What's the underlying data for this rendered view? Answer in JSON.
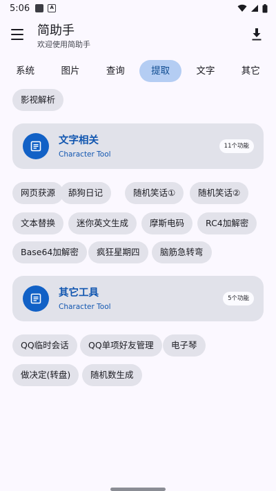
{
  "status": {
    "time": "5:06",
    "notif_letter": "A"
  },
  "app": {
    "title": "简助手",
    "subtitle": "欢迎使用简助手"
  },
  "tabs": [
    {
      "label": "系统",
      "active": false
    },
    {
      "label": "图片",
      "active": false
    },
    {
      "label": "查询",
      "active": false
    },
    {
      "label": "提取",
      "active": true
    },
    {
      "label": "文字",
      "active": false
    },
    {
      "label": "其它",
      "active": false
    }
  ],
  "top_chip": "影视解析",
  "section_text": {
    "title": "文字相关",
    "subtitle": "Character Tool",
    "badge": "11个功能",
    "items": [
      "网页获源",
      "舔狗日记",
      "随机笑话①",
      "随机笑话②",
      "文本替换",
      "迷你英文生成",
      "摩斯电码",
      "RC4加解密",
      "Base64加解密",
      "疯狂星期四",
      "脑筋急转弯"
    ]
  },
  "section_other": {
    "title": "其它工具",
    "subtitle": "Character Tool",
    "badge": "5个功能",
    "items": [
      "QQ临时会话",
      "QQ单项好友管理",
      "电子琴",
      "做决定(转盘)",
      "随机数生成"
    ]
  },
  "colors": {
    "accent": "#1261c6",
    "tab_active_bg": "#b4cdf3",
    "chip_bg": "#e2e2ea",
    "card_bg": "#e1e2ea",
    "page_bg": "#fbf8ff"
  }
}
